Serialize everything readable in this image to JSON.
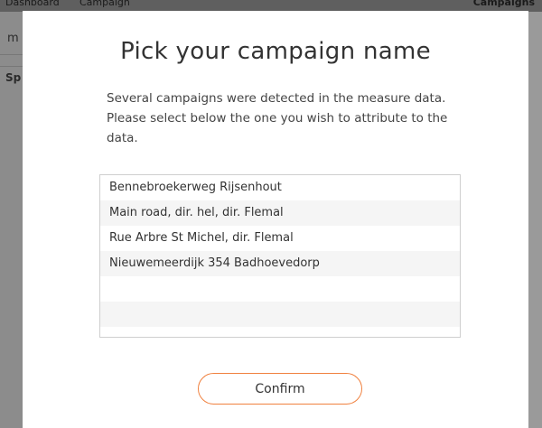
{
  "background": {
    "topbar_left": "Dashboard",
    "topbar_mid": "Campaign",
    "topbar_right": "Campaigns",
    "left_letter": "m",
    "left_label": "Sp"
  },
  "dialog": {
    "title": "Pick your campaign name",
    "description": "Several campaigns were detected in the measure data. Please select below the one you wish to attribute to the data.",
    "campaigns": [
      "Bennebroekerweg Rijsenhout",
      "Main road, dir. hel, dir. Flemal",
      "Rue Arbre St Michel, dir. Flemal",
      "Nieuwemeerdijk 354 Badhoevedorp"
    ],
    "confirm_label": "Confirm",
    "accent_color": "#f0813f"
  }
}
